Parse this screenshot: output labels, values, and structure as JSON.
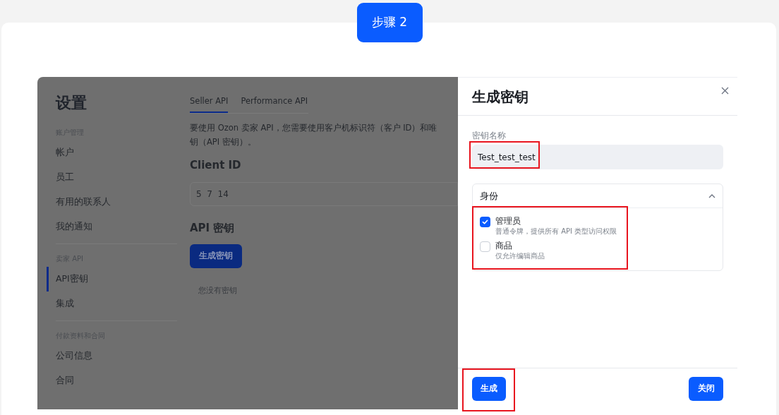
{
  "step_badge": "步骤 2",
  "settings": {
    "title": "设置",
    "sidebar": [
      {
        "heading": "账户管理",
        "items": [
          {
            "label": "帐户",
            "selected": false
          },
          {
            "label": "员工",
            "selected": false
          },
          {
            "label": "有用的联系人",
            "selected": false
          },
          {
            "label": "我的通知",
            "selected": false
          }
        ]
      },
      {
        "heading": "卖家 API",
        "items": [
          {
            "label": "API密钥",
            "selected": true
          },
          {
            "label": "集成",
            "selected": false
          }
        ]
      },
      {
        "heading": "付款资料和合同",
        "items": [
          {
            "label": "公司信息",
            "selected": false
          },
          {
            "label": "合同",
            "selected": false
          }
        ]
      }
    ],
    "tabs": [
      {
        "label": "Seller API",
        "selected": true
      },
      {
        "label": "Performance API",
        "selected": false
      }
    ],
    "description_lines": [
      "要使用 Ozon 卖家 API，您需要使用客户机标识符（客户 ID）和唯",
      "钥（API 密钥）。"
    ],
    "client_id": {
      "label": "Client ID",
      "value": "5  7  14"
    },
    "api_keys": {
      "heading": "API 密钥",
      "button": "生成密钥",
      "empty": "您没有密钥"
    }
  },
  "drawer": {
    "title": "生成密钥",
    "name_field": {
      "label": "密钥名称",
      "value": "Test_test_test"
    },
    "roles": {
      "label": "身份",
      "expanded": true,
      "options": [
        {
          "label": "管理员",
          "hint": "普通令牌，提供所有 API 类型访问权限",
          "checked": true
        },
        {
          "label": "商品",
          "hint": "仅允许编辑商品",
          "checked": false
        }
      ]
    },
    "buttons": {
      "generate": "生成",
      "close": "关闭"
    }
  }
}
